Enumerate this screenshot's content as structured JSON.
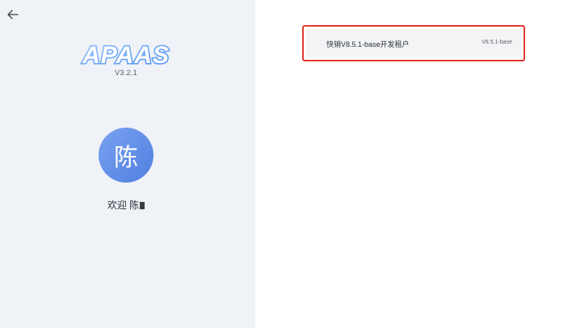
{
  "header": {
    "back_icon": "arrow-left-icon"
  },
  "brand": {
    "name": "APAAS",
    "version": "V3.2.1",
    "color": "#6ea8f5"
  },
  "user": {
    "avatar_char": "陈",
    "welcome_text": "欢迎 陈",
    "avatar_color": "#5b8be6"
  },
  "tenants": [
    {
      "name": "快销V8.5.1-base开发租户",
      "version": "V8.5.1-base",
      "highlight_color": "#e43a2f"
    }
  ]
}
